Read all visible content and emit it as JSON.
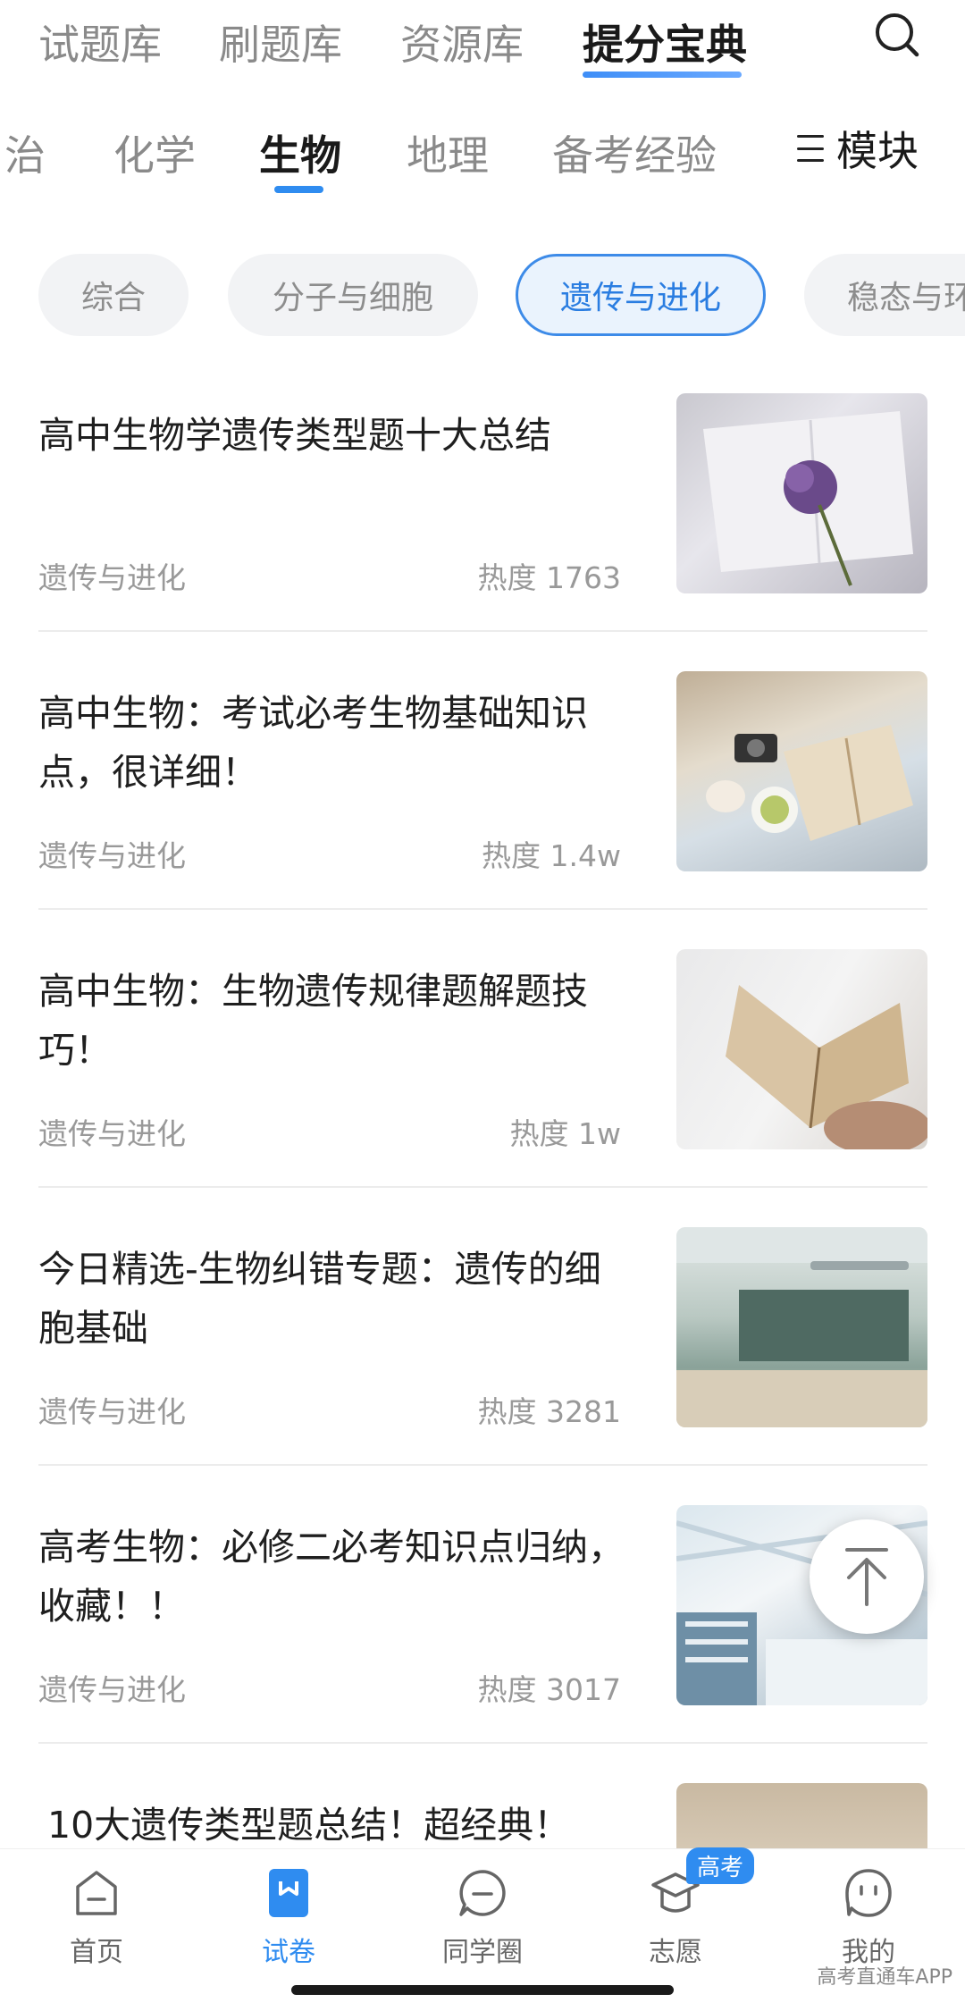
{
  "top_tabs": [
    {
      "label": "试题库"
    },
    {
      "label": "刷题库"
    },
    {
      "label": "资源库"
    },
    {
      "label": "提分宝典",
      "active": true
    }
  ],
  "subject_tabs": [
    {
      "label": "治"
    },
    {
      "label": "化学"
    },
    {
      "label": "生物",
      "active": true
    },
    {
      "label": "地理"
    },
    {
      "label": "备考经验"
    }
  ],
  "module_button": {
    "label": "模块",
    "icon": "menu-icon"
  },
  "chips": [
    {
      "label": "综合"
    },
    {
      "label": "分子与细胞"
    },
    {
      "label": "遗传与进化",
      "active": true
    },
    {
      "label": "稳态与环"
    }
  ],
  "articles": [
    {
      "title": "高中生物学遗传类型题十大总结",
      "tag": "遗传与进化",
      "heat": "热度 1763",
      "thumb": "book-with-flower"
    },
    {
      "title": "高中生物：考试必考生物基础知识点，很详细！",
      "tag": "遗传与进化",
      "heat": "热度 1.4w",
      "thumb": "book-on-beach"
    },
    {
      "title": "高中生物：生物遗传规律题解题技巧！",
      "tag": "遗传与进化",
      "heat": "热度 1w",
      "thumb": "open-book-in-hand"
    },
    {
      "title": "今日精选-生物纠错专题：遗传的细胞基础",
      "tag": "遗传与进化",
      "heat": "热度 3281",
      "thumb": "classroom"
    },
    {
      "title": "高考生物：必修二必考知识点归纳，收藏！！",
      "tag": "遗传与进化",
      "heat": "热度 3017",
      "thumb": "library"
    },
    {
      "title": "10大遗传类型题总结！超经典！",
      "tag": "",
      "heat": "",
      "thumb": "blurred-photo"
    }
  ],
  "bottom_nav": [
    {
      "label": "首页",
      "icon": "home-icon"
    },
    {
      "label": "试卷",
      "icon": "paper-icon",
      "active": true
    },
    {
      "label": "同学圈",
      "icon": "chat-icon"
    },
    {
      "label": "志愿",
      "icon": "graduation-cap-icon",
      "badge": "高考"
    },
    {
      "label": "我的",
      "icon": "profile-icon"
    }
  ],
  "watermark": "高考直通车APP",
  "colors": {
    "accent": "#2f8cf0",
    "chip_active_bg": "#eaf3fd",
    "muted": "#999999"
  }
}
